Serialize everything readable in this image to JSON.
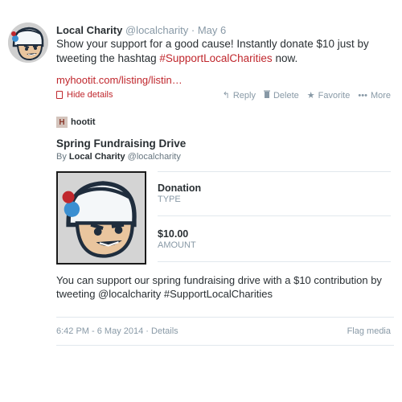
{
  "tweet": {
    "name": "Local Charity",
    "handle": "@localcharity",
    "separator": "·",
    "date": "May 6",
    "text_before": "Show your support for a good cause! Instantly donate $10 just by tweeting the hashtag ",
    "hashtag": "#SupportLocalCharities",
    "text_after": " now.",
    "link": "myhootit.com/listing/listin…",
    "hide_details": "Hide details",
    "actions": [
      {
        "icon": "reply-icon",
        "glyph": "↰",
        "label": "Reply"
      },
      {
        "icon": "trash-icon",
        "glyph": "🗑",
        "label": "Delete"
      },
      {
        "icon": "star-icon",
        "glyph": "★",
        "label": "Favorite"
      },
      {
        "icon": "more-icon",
        "glyph": "•••",
        "label": "More"
      }
    ]
  },
  "card": {
    "brand_letter": "H",
    "brand_name": "hootit",
    "title": "Spring Fundraising Drive",
    "by_prefix": "By",
    "author": "Local Charity",
    "author_handle": "@localcharity",
    "fields": [
      {
        "value": "Donation",
        "label": "TYPE"
      },
      {
        "value": "$10.00",
        "label": "AMOUNT"
      }
    ],
    "description": "You can support our spring fundraising drive with a $10 contribution by tweeting @localcharity #SupportLocalCharities"
  },
  "footer": {
    "time": "6:42 PM - 6 May 2014",
    "separator": "·",
    "details": "Details",
    "flag_media": "Flag media"
  },
  "colors": {
    "accent": "#c0272d",
    "muted": "#8899a6",
    "text": "#292f33",
    "divider": "#e1e8ed"
  }
}
